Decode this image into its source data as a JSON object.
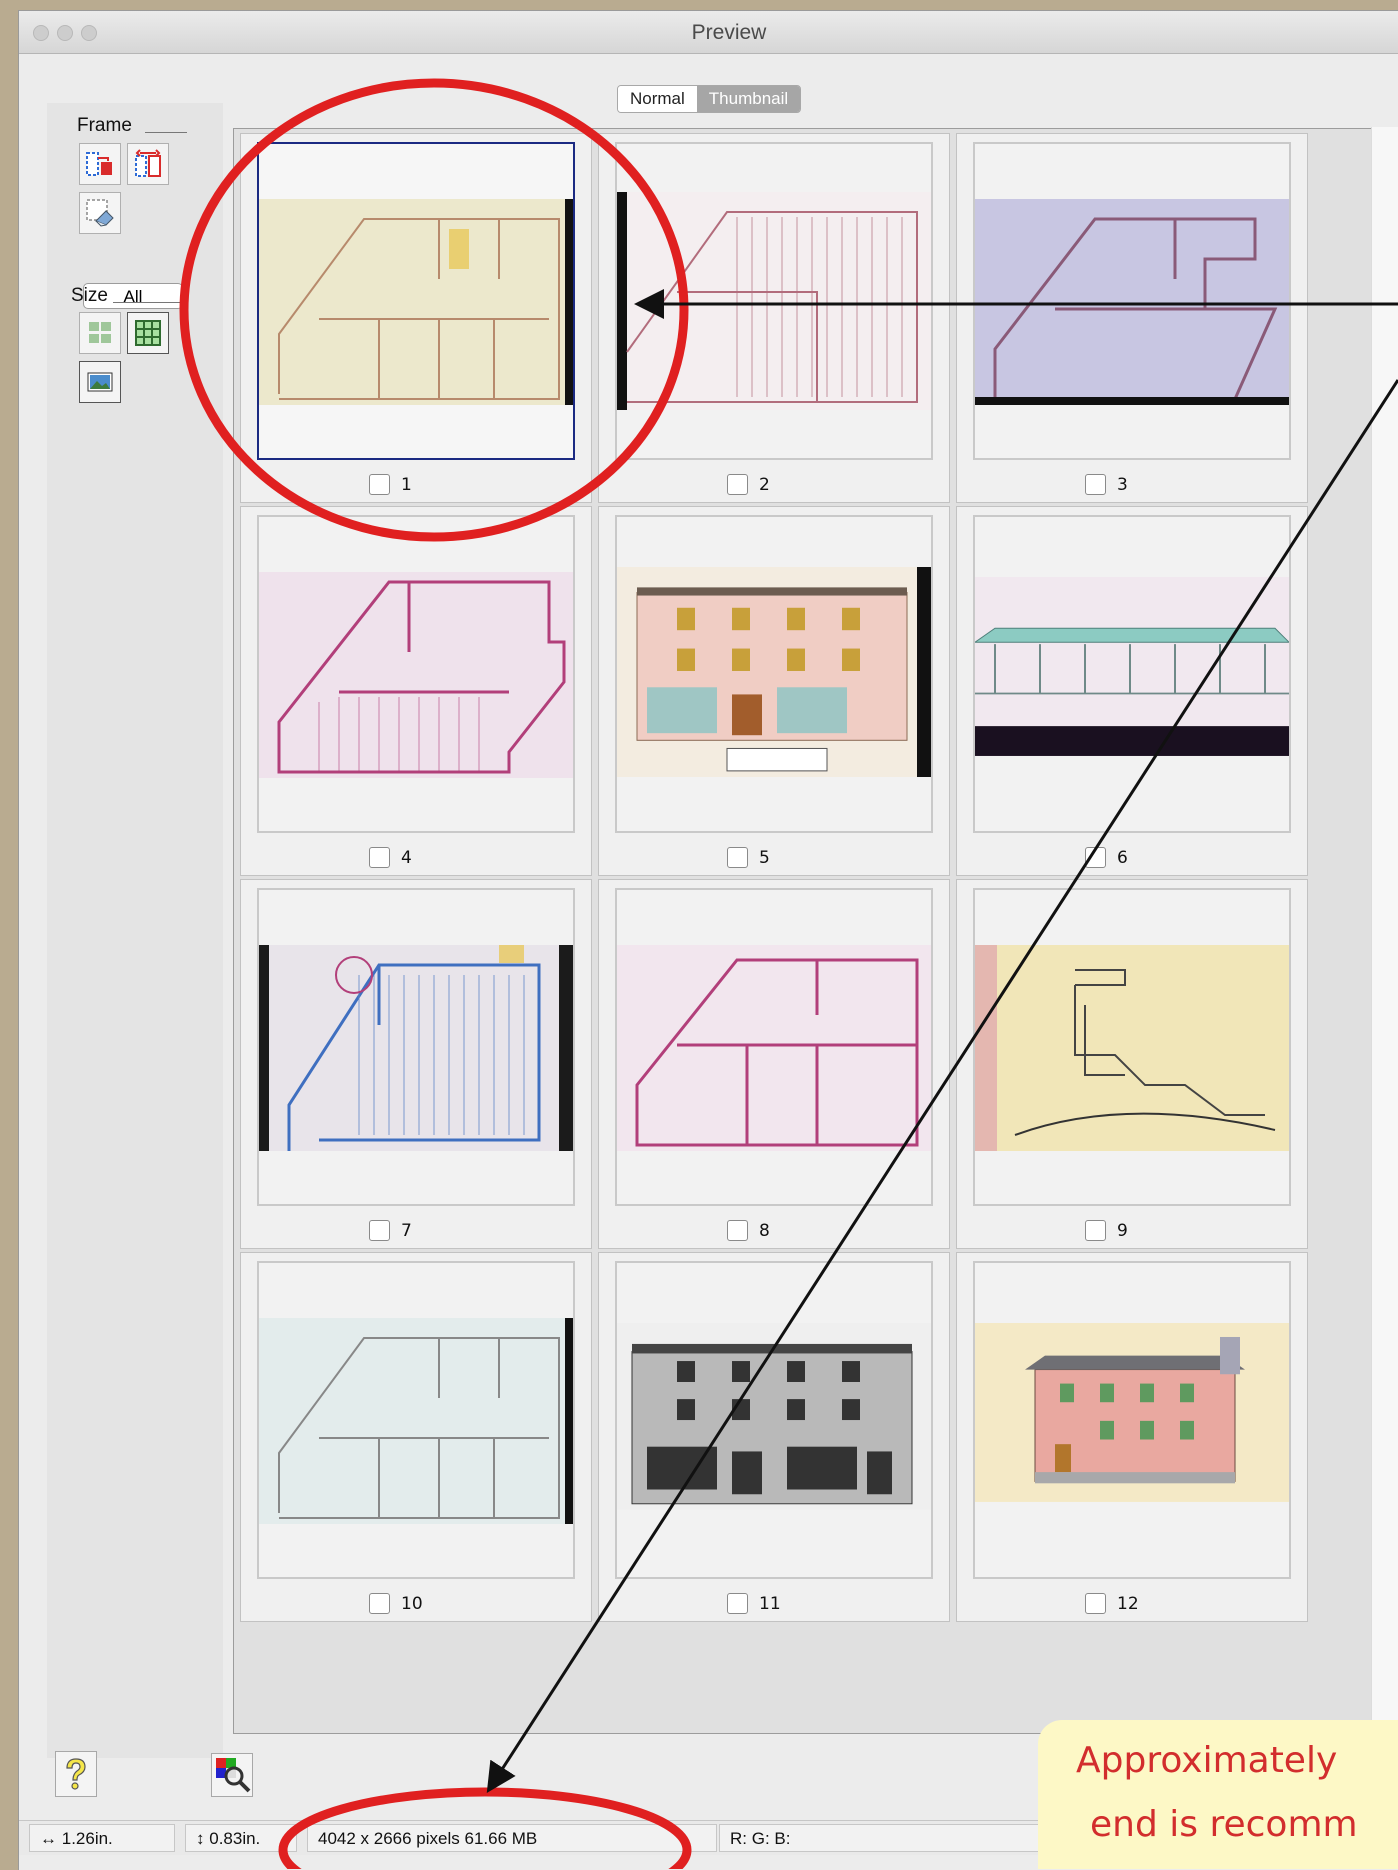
{
  "window": {
    "title": "Preview"
  },
  "view_toggle": {
    "normal": "Normal",
    "thumbnail": "Thumbnail",
    "selected": "Thumbnail"
  },
  "sidebar": {
    "frame_label": "Frame",
    "all_label": "All",
    "size_label": "Size"
  },
  "thumbnails": [
    {
      "num": "1",
      "checked": false
    },
    {
      "num": "2",
      "checked": false
    },
    {
      "num": "3",
      "checked": false
    },
    {
      "num": "4",
      "checked": false
    },
    {
      "num": "5",
      "checked": false
    },
    {
      "num": "6",
      "checked": false
    },
    {
      "num": "7",
      "checked": false
    },
    {
      "num": "8",
      "checked": false
    },
    {
      "num": "9",
      "checked": false
    },
    {
      "num": "10",
      "checked": false
    },
    {
      "num": "11",
      "checked": false
    },
    {
      "num": "12",
      "checked": false
    }
  ],
  "status": {
    "width": "1.26in.",
    "height": "0.83in.",
    "dims": "4042 x 2666 pixels 61.66 MB",
    "rgb": "R: G: B:"
  },
  "callout": {
    "line1": "Approximately",
    "line2": "end is recomm"
  },
  "colors": {
    "annotation_red": "#e02020",
    "selection_blue": "#1b2a82"
  }
}
